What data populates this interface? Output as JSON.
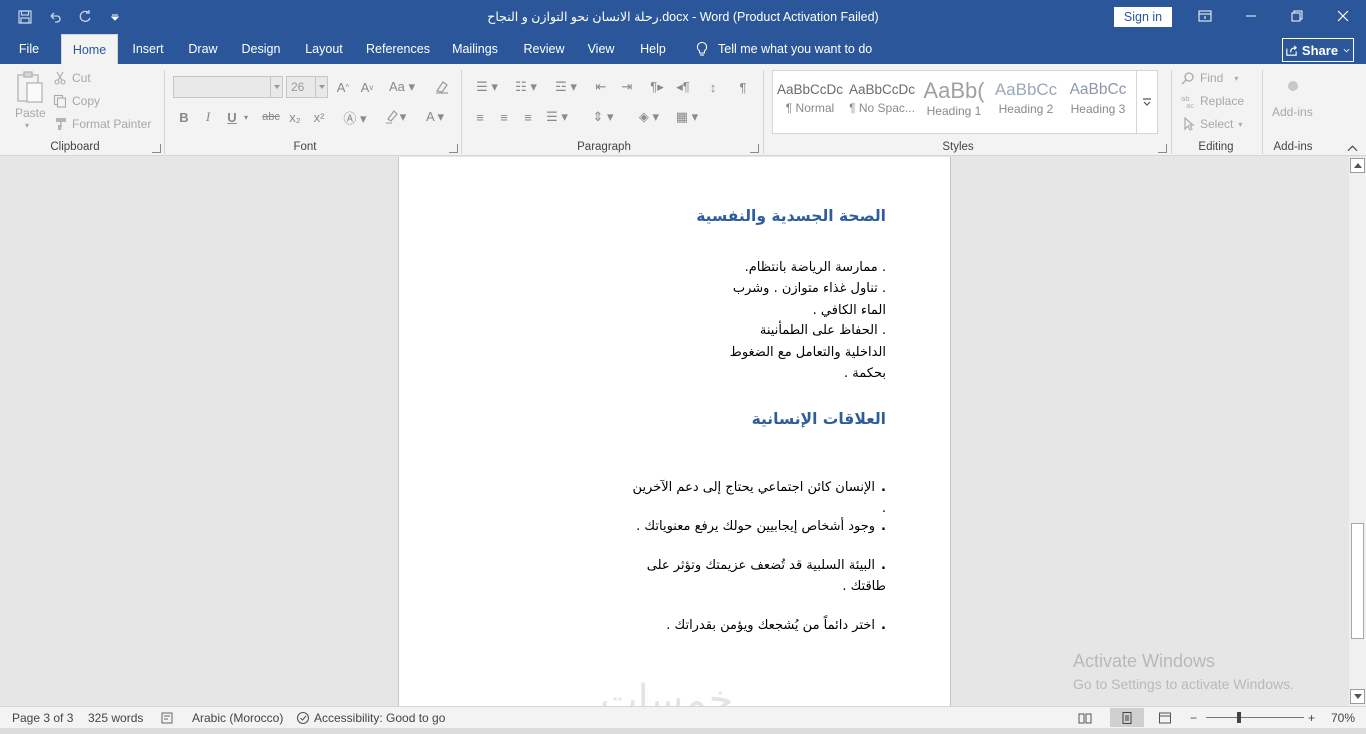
{
  "window": {
    "title": "رحلة الانسان نحو التوازن و النجاح.docx  -  Word (Product Activation Failed)",
    "sign_in": "Sign in"
  },
  "tabs": [
    {
      "label": "File"
    },
    {
      "label": "Home"
    },
    {
      "label": "Insert"
    },
    {
      "label": "Draw"
    },
    {
      "label": "Design"
    },
    {
      "label": "Layout"
    },
    {
      "label": "References"
    },
    {
      "label": "Mailings"
    },
    {
      "label": "Review"
    },
    {
      "label": "View"
    },
    {
      "label": "Help"
    }
  ],
  "tell_me": "Tell me what you want to do",
  "share": "Share",
  "ribbon": {
    "clipboard": {
      "paste": "Paste",
      "cut": "Cut",
      "copy": "Copy",
      "format_painter": "Format Painter",
      "label": "Clipboard"
    },
    "font": {
      "name": "",
      "size": "26",
      "label": "Font",
      "bold": "B",
      "italic": "I",
      "underline": "U",
      "strike": "abc",
      "sub": "x₂",
      "sup": "x²"
    },
    "paragraph": {
      "label": "Paragraph"
    },
    "styles": {
      "label": "Styles",
      "items": [
        {
          "preview": "AaBbCcDc",
          "name": "¶ Normal"
        },
        {
          "preview": "AaBbCcDc",
          "name": "¶ No Spac..."
        },
        {
          "preview": "AaBb(",
          "name": "Heading 1"
        },
        {
          "preview": "AaBbCc",
          "name": "Heading 2"
        },
        {
          "preview": "AaBbCc",
          "name": "Heading 3"
        }
      ]
    },
    "editing": {
      "find": "Find",
      "replace": "Replace",
      "select": "Select",
      "label": "Editing"
    },
    "addins": {
      "button": "Add-ins",
      "label": "Add-ins"
    }
  },
  "document": {
    "section1": {
      "heading": "الصحة الجسدية والنفسية",
      "lines": [
        ". ممارسة الرياضة بانتظام.",
        ". تناول غذاء متوازن . وشرب الماء الكافي .",
        ". الحفاظ على الطمأنينة الداخلية والتعامل مع الضغوط بحكمة ."
      ]
    },
    "section2": {
      "heading": "العلاقات الإنسانية",
      "bullets": [
        "الإنسان كائن اجتماعي يحتاج إلى دعم الآخرين .",
        "وجود أشخاص إيجابيين حولك يرفع معنوياتك .",
        "البيئة السلبية قد تُضعف عزيمتك وتؤثر على طاقتك .",
        "اختر دائماً من يُشجعك ويؤمن بقدراتك ."
      ]
    }
  },
  "overlay": {
    "activate_title": "Activate Windows",
    "activate_sub": "Go to Settings to activate Windows.",
    "watermark": "خمسات"
  },
  "status": {
    "page": "Page 3 of 3",
    "words": "325 words",
    "language": "Arabic (Morocco)",
    "accessibility": "Accessibility: Good to go",
    "zoom": "70%",
    "zoom_minus": "−",
    "zoom_plus": "+"
  }
}
